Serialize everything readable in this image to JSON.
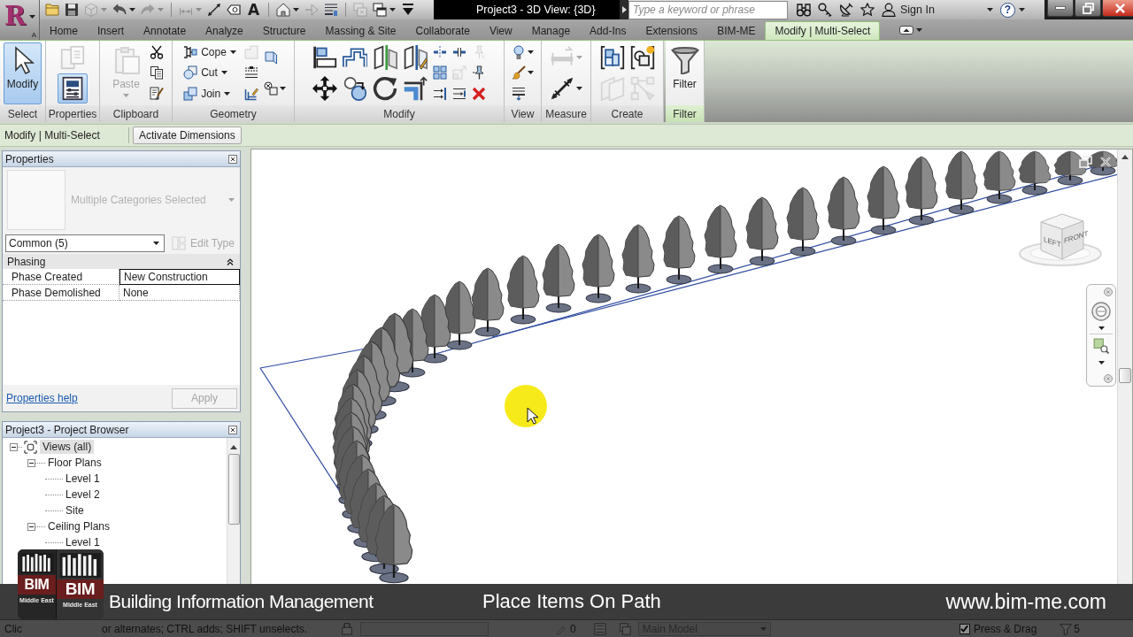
{
  "app_button": {
    "letter": "R",
    "keytip": "A"
  },
  "quick_access": [
    [
      {
        "kind": "icon",
        "disabled": false
      },
      {
        "kind": "icon",
        "disabled": false
      },
      {
        "kind": "icon",
        "disabled": true,
        "dropdown": true
      },
      {
        "kind": "icon",
        "disabled": false,
        "dropdown": true
      },
      {
        "kind": "icon",
        "disabled": true,
        "dropdown": true
      }
    ],
    [
      {
        "kind": "icon",
        "disabled": true,
        "dropdown": true
      },
      {
        "kind": "icon",
        "disabled": false
      },
      {
        "kind": "icon",
        "disabled": false
      },
      {
        "kind": "glyph",
        "text": "A",
        "disabled": false
      }
    ],
    [
      {
        "kind": "icon",
        "disabled": false,
        "dropdown": true
      },
      {
        "kind": "icon",
        "disabled": true
      },
      {
        "kind": "icon",
        "disabled": false
      }
    ],
    [
      {
        "kind": "icon",
        "disabled": true
      },
      {
        "kind": "icon",
        "disabled": false,
        "dropdown": true
      },
      {
        "kind": "icon",
        "disabled": false
      }
    ]
  ],
  "window": {
    "title": "Project3 - 3D View: {3D}"
  },
  "search": {
    "placeholder": "Type a keyword or phrase"
  },
  "sign_in": {
    "label": "Sign In"
  },
  "help": {
    "glyph": "?"
  },
  "tabs": [
    {
      "label": "Home",
      "selected": false
    },
    {
      "label": "Insert",
      "selected": false
    },
    {
      "label": "Annotate",
      "selected": false
    },
    {
      "label": "Analyze",
      "selected": false
    },
    {
      "label": "Structure",
      "selected": false
    },
    {
      "label": "Massing & Site",
      "selected": false
    },
    {
      "label": "Collaborate",
      "selected": false
    },
    {
      "label": "View",
      "selected": false
    },
    {
      "label": "Manage",
      "selected": false
    },
    {
      "label": "Add-Ins",
      "selected": false
    },
    {
      "label": "Extensions",
      "selected": false
    },
    {
      "label": "BIM-ME",
      "selected": false
    },
    {
      "label": "Modify | Multi-Select",
      "selected": true
    }
  ],
  "ribbon": {
    "panels": [
      {
        "label": "Select",
        "contextual": false,
        "columns": [
          [
            {
              "kind": "large",
              "label": "Modify",
              "selected": true,
              "disabled": false
            }
          ]
        ]
      },
      {
        "label": "Properties",
        "contextual": false,
        "columns": [
          [
            {
              "kind": "medium",
              "selected": false,
              "disabled": true
            },
            {
              "kind": "medium",
              "selected": true,
              "disabled": false
            }
          ]
        ]
      },
      {
        "label": "Clipboard",
        "contextual": false,
        "columns": [
          [
            {
              "kind": "large",
              "label": "Paste",
              "disabled": true,
              "dropdown": true
            }
          ],
          [
            {
              "kind": "icon",
              "disabled": false
            },
            {
              "kind": "icon",
              "disabled": false
            },
            {
              "kind": "icon",
              "disabled": false
            }
          ]
        ]
      },
      {
        "label": "Geometry",
        "contextual": false,
        "columns": [
          [
            {
              "kind": "small",
              "label": "Cope",
              "disabled": false,
              "dropdown": true
            },
            {
              "kind": "small",
              "label": "Cut",
              "disabled": false,
              "dropdown": true
            },
            {
              "kind": "small",
              "label": "Join",
              "disabled": false,
              "dropdown": true
            }
          ],
          [
            {
              "kind": "icon",
              "disabled": true
            },
            {
              "kind": "icon",
              "disabled": false
            },
            {
              "kind": "icon",
              "disabled": false
            }
          ],
          [
            {
              "kind": "icon",
              "disabled": false
            },
            {
              "kind": "icon",
              "disabled": false,
              "dropdown": true
            }
          ]
        ]
      },
      {
        "label": "Modify",
        "contextual": false,
        "columns": [
          [
            {
              "kind": "medium",
              "disabled": false
            },
            {
              "kind": "medium",
              "disabled": false
            }
          ],
          [
            {
              "kind": "medium",
              "disabled": false
            },
            {
              "kind": "medium",
              "disabled": false
            }
          ],
          [
            {
              "kind": "medium",
              "disabled": false
            },
            {
              "kind": "medium",
              "disabled": false
            }
          ],
          [
            {
              "kind": "medium",
              "disabled": false
            },
            {
              "kind": "medium",
              "disabled": false
            }
          ],
          [
            {
              "kind": "icon",
              "disabled": false
            },
            {
              "kind": "icon",
              "disabled": false
            },
            {
              "kind": "icon",
              "disabled": false
            }
          ],
          [
            {
              "kind": "icon",
              "disabled": false
            },
            {
              "kind": "icon",
              "disabled": true
            },
            {
              "kind": "icon",
              "disabled": false
            }
          ],
          [
            {
              "kind": "icon",
              "disabled": true
            },
            {
              "kind": "icon",
              "disabled": false
            },
            {
              "kind": "icon",
              "disabled": false
            }
          ]
        ]
      },
      {
        "label": "View",
        "contextual": false,
        "columns": [
          [
            {
              "kind": "icon",
              "disabled": false,
              "dropdown": true
            },
            {
              "kind": "icon",
              "disabled": false,
              "dropdown": true
            },
            {
              "kind": "icon",
              "disabled": false
            }
          ]
        ]
      },
      {
        "label": "Measure",
        "contextual": false,
        "columns": [
          [
            {
              "kind": "medium",
              "disabled": true,
              "dropdown": true
            },
            {
              "kind": "medium",
              "disabled": false,
              "dropdown": true
            }
          ]
        ]
      },
      {
        "label": "Create",
        "contextual": false,
        "columns": [
          [
            {
              "kind": "medium",
              "disabled": false
            },
            {
              "kind": "medium",
              "disabled": true
            }
          ],
          [
            {
              "kind": "medium",
              "disabled": false
            },
            {
              "kind": "medium",
              "disabled": true
            }
          ]
        ]
      },
      {
        "label": "Filter",
        "contextual": true,
        "columns": [
          [
            {
              "kind": "large",
              "label": "Filter",
              "disabled": false
            }
          ]
        ]
      }
    ]
  },
  "options_bar": {
    "mode": "Modify | Multi-Select",
    "button": "Activate Dimensions"
  },
  "properties": {
    "title": "Properties",
    "type_name": "Multiple Categories Selected",
    "filter": "Common (5)",
    "edit_type": {
      "label": "Edit Type",
      "disabled": true
    },
    "groups": [
      {
        "name": "Phasing",
        "expanded": true,
        "rows": [
          {
            "name": "Phase Created",
            "value": "New Construction",
            "selected": true
          },
          {
            "name": "Phase Demolished",
            "value": "None",
            "selected": false
          }
        ]
      }
    ],
    "help_link": "Properties help",
    "apply": {
      "label": "Apply",
      "disabled": true
    }
  },
  "project_browser": {
    "title": "Project3 - Project Browser",
    "tree": [
      {
        "label": "Views (all)",
        "selected": true,
        "expanded": true,
        "children": [
          {
            "label": "Floor Plans",
            "selected": false,
            "expanded": true,
            "children": [
              {
                "label": "Level 1",
                "selected": false
              },
              {
                "label": "Level 2",
                "selected": false
              },
              {
                "label": "Site",
                "selected": false
              }
            ]
          },
          {
            "label": "Ceiling Plans",
            "selected": false,
            "expanded": true,
            "children": [
              {
                "label": "Level 1",
                "selected": false
              }
            ]
          }
        ]
      }
    ]
  },
  "view_3d": {
    "view_cube": {
      "faces": [
        "LEFT",
        "FRONT"
      ]
    }
  },
  "banner": {
    "logo": {
      "faces": [
        {
          "name": "BIM",
          "subtitle": "Middle East"
        },
        {
          "name": "BIM",
          "subtitle": "Middle East"
        }
      ]
    },
    "tagline": "Building Information Management",
    "title": "Place Items On Path",
    "website": "www.bim-me.com"
  },
  "status_bar": {
    "hint": [
      "Clic",
      "or alternates; CTRL adds; SHIFT unselects."
    ],
    "editable_count": "0",
    "model": {
      "value": "Main Model",
      "disabled": true
    },
    "press_drag": {
      "label": "Press & Drag",
      "checked": true
    },
    "filter_count": "5"
  }
}
